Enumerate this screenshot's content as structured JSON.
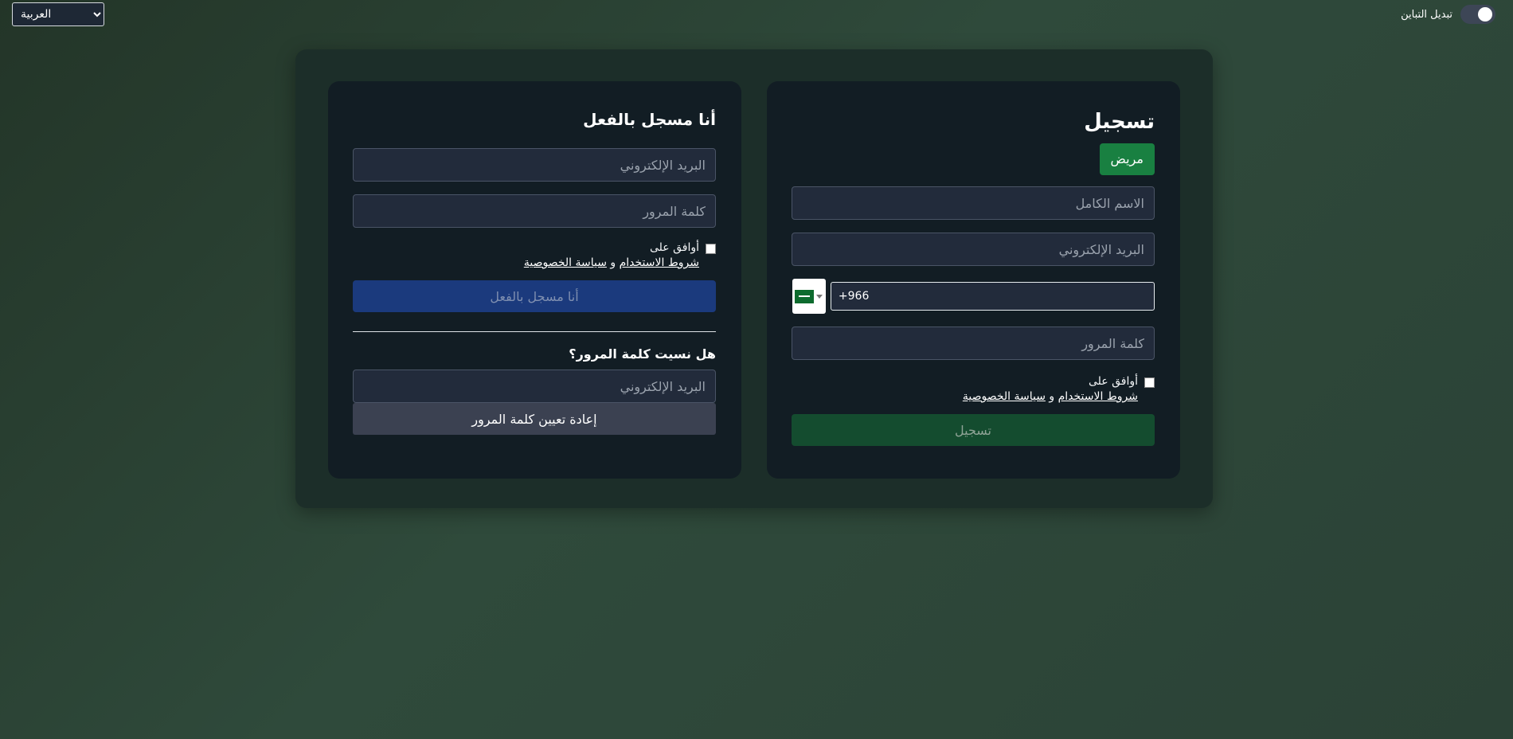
{
  "top": {
    "language_selected": "العربية",
    "contrast_label": "تبديل التباين"
  },
  "register": {
    "title": "تسجيل",
    "role_button": "مريض",
    "fullname_placeholder": "الاسم الكامل",
    "email_placeholder": "البريد الإلكتروني",
    "phone_value": "+966",
    "password_placeholder": "كلمة المرور",
    "agree_prefix": "أوافق على",
    "terms_link": "شروط الاستخدام",
    "and_word": "و",
    "privacy_link": "سياسة الخصوصية",
    "submit": "تسجيل"
  },
  "login": {
    "title": "أنا مسجل بالفعل",
    "email_placeholder": "البريد الإلكتروني",
    "password_placeholder": "كلمة المرور",
    "agree_prefix": "أوافق على",
    "terms_link": "شروط الاستخدام",
    "and_word": "و",
    "privacy_link": "سياسة الخصوصية",
    "submit": "أنا مسجل بالفعل",
    "forgot_title": "هل نسيت كلمة المرور؟",
    "forgot_email_placeholder": "البريد الإلكتروني",
    "reset_button": "إعادة تعيين كلمة المرور"
  },
  "icons": {
    "flag": "saudi-flag-icon",
    "dropdown": "chevron-down-icon"
  },
  "colors": {
    "role_button": "#198041",
    "register_button": "#144c2f",
    "login_button": "#1b3a7d",
    "reset_button": "#3b4151"
  }
}
